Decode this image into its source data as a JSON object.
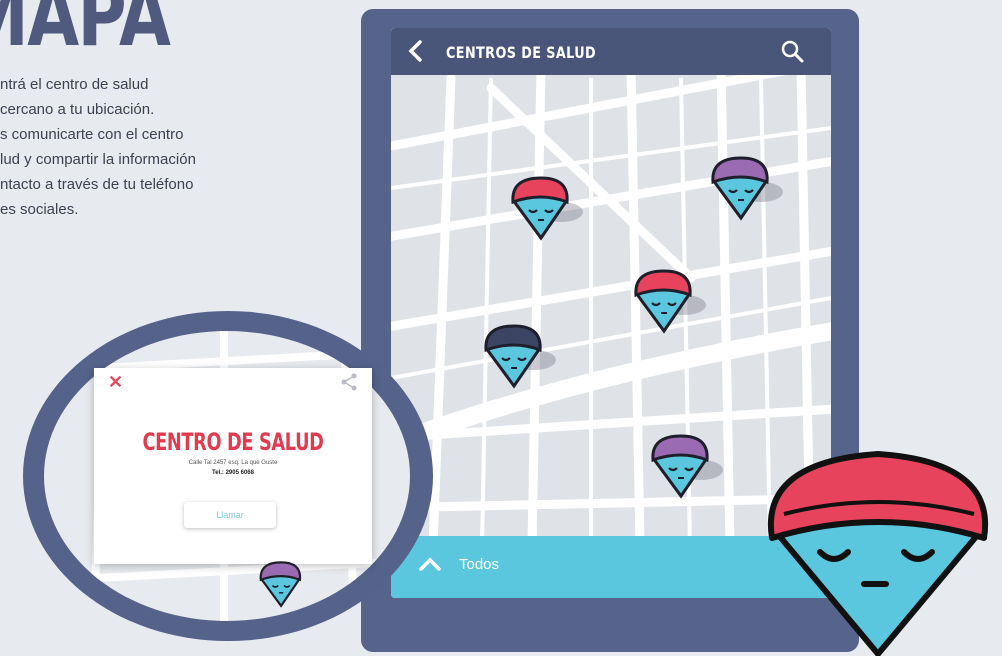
{
  "intro": {
    "title": "MAPA",
    "lines": [
      "ntrá el centro de salud",
      "cercano a tu ubicación.",
      "s comunicarte con el centro",
      "lud y compartir la información",
      "ntacto a través de tu teléfono",
      "es sociales."
    ]
  },
  "app": {
    "header_title": "CENTROS DE SALUD",
    "back_icon": "chevron-left-icon",
    "search_icon": "search-icon",
    "bottom_label": "Todos",
    "bottom_icon": "chevron-up-icon",
    "pins": [
      {
        "color": "#e8435c"
      },
      {
        "color": "#9a6bb2"
      },
      {
        "color": "#e8435c"
      },
      {
        "color": "#3c4463"
      },
      {
        "color": "#9a6bb2"
      }
    ]
  },
  "detail_card": {
    "title": "CENTRO DE SALUD",
    "address": "Calle Tal 2457 esq. La que Guste",
    "phone": "Tel.: 2905 6068",
    "call_button": "Llamar",
    "close_icon": "close-icon",
    "share_icon": "share-icon"
  },
  "colors": {
    "background": "#e7ebf0",
    "phone_frame": "#56638b",
    "header": "#4a5679",
    "accent_cyan": "#5bc7de",
    "pin_face": "#5bc7de",
    "pin_red": "#e8435c",
    "pin_purple": "#9a6bb2",
    "pin_navy": "#3c4463"
  }
}
